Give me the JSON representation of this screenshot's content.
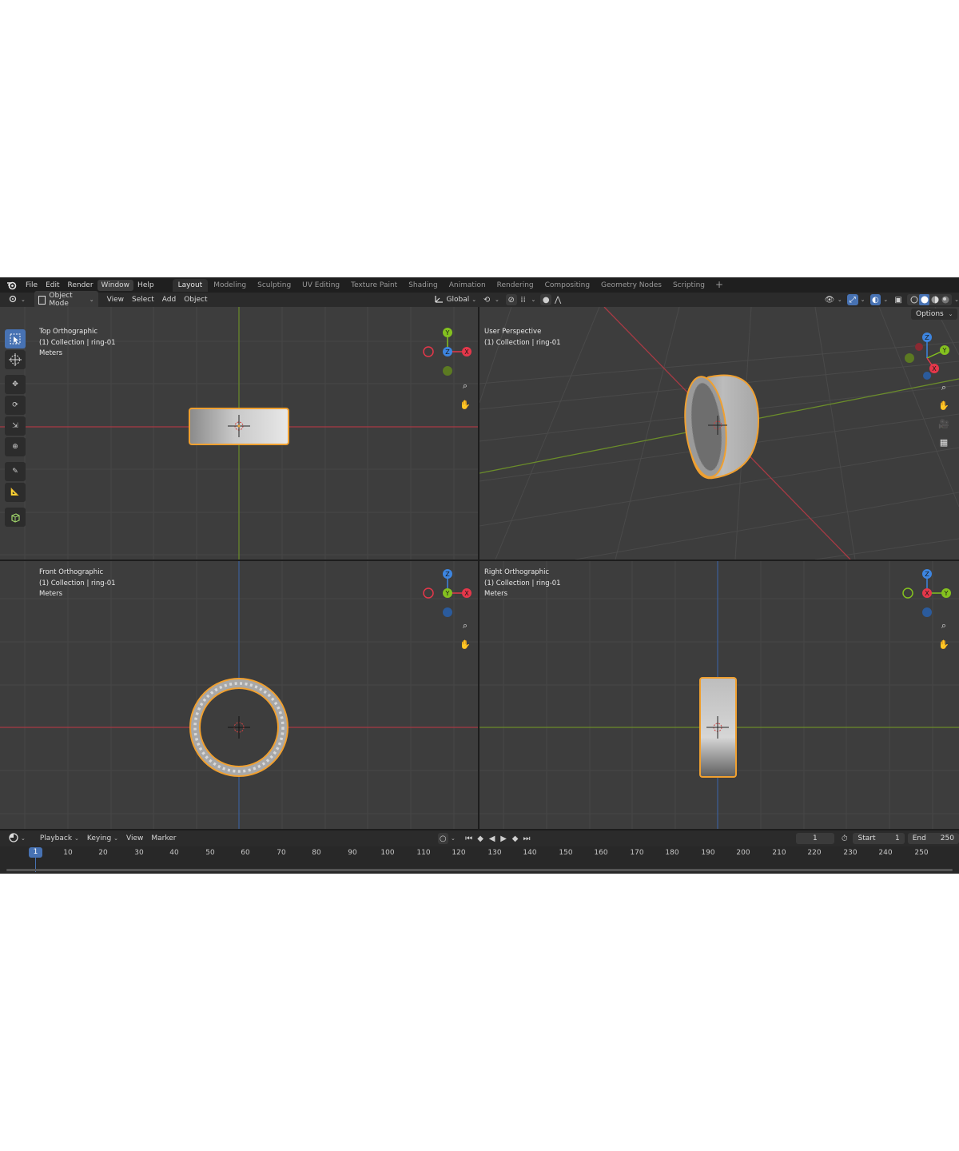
{
  "topbar": {
    "menus": [
      "File",
      "Edit",
      "Render",
      "Window",
      "Help"
    ],
    "active_menu": "Window",
    "workspace_tabs": [
      "Layout",
      "Modeling",
      "Sculpting",
      "UV Editing",
      "Texture Paint",
      "Shading",
      "Animation",
      "Rendering",
      "Compositing",
      "Geometry Nodes",
      "Scripting"
    ],
    "active_tab": "Layout",
    "add_tab": "+"
  },
  "header": {
    "mode": "Object Mode",
    "menus": [
      "View",
      "Select",
      "Add",
      "Object"
    ],
    "orientation": "Global",
    "options_label": "Options"
  },
  "viewports": [
    {
      "name": "Top Orthographic",
      "collection": "(1) Collection | ring-01",
      "units": "Meters"
    },
    {
      "name": "User Perspective",
      "collection": "(1) Collection | ring-01",
      "units": ""
    },
    {
      "name": "Front Orthographic",
      "collection": "(1) Collection | ring-01",
      "units": "Meters"
    },
    {
      "name": "Right Orthographic",
      "collection": "(1) Collection | ring-01",
      "units": "Meters"
    }
  ],
  "axes": {
    "x": "X",
    "y": "Y",
    "z": "Z"
  },
  "timeline": {
    "menus": [
      "Playback",
      "Keying",
      "View",
      "Marker"
    ],
    "current_frame": "1",
    "start_label": "Start",
    "start_value": "1",
    "end_label": "End",
    "end_value": "250",
    "ticks": [
      "10",
      "20",
      "30",
      "40",
      "50",
      "60",
      "70",
      "80",
      "90",
      "100",
      "110",
      "120",
      "130",
      "140",
      "150",
      "160",
      "170",
      "180",
      "190",
      "200",
      "210",
      "220",
      "230",
      "240",
      "250"
    ]
  },
  "colors": {
    "accent": "#4772b3",
    "selection": "#f0a030",
    "axis_x": "#e5374a",
    "axis_y": "#84c11f",
    "axis_z": "#3d85e0"
  },
  "icons": [
    "blender-logo-icon",
    "editor-type-icon",
    "select-box-icon",
    "cursor-icon",
    "move-icon",
    "rotate-icon",
    "scale-icon",
    "transform-icon",
    "annotate-icon",
    "measure-icon",
    "add-cube-icon",
    "zoom-icon",
    "hand-icon",
    "camera-icon",
    "grid-icon",
    "play-icon",
    "clock-icon"
  ]
}
